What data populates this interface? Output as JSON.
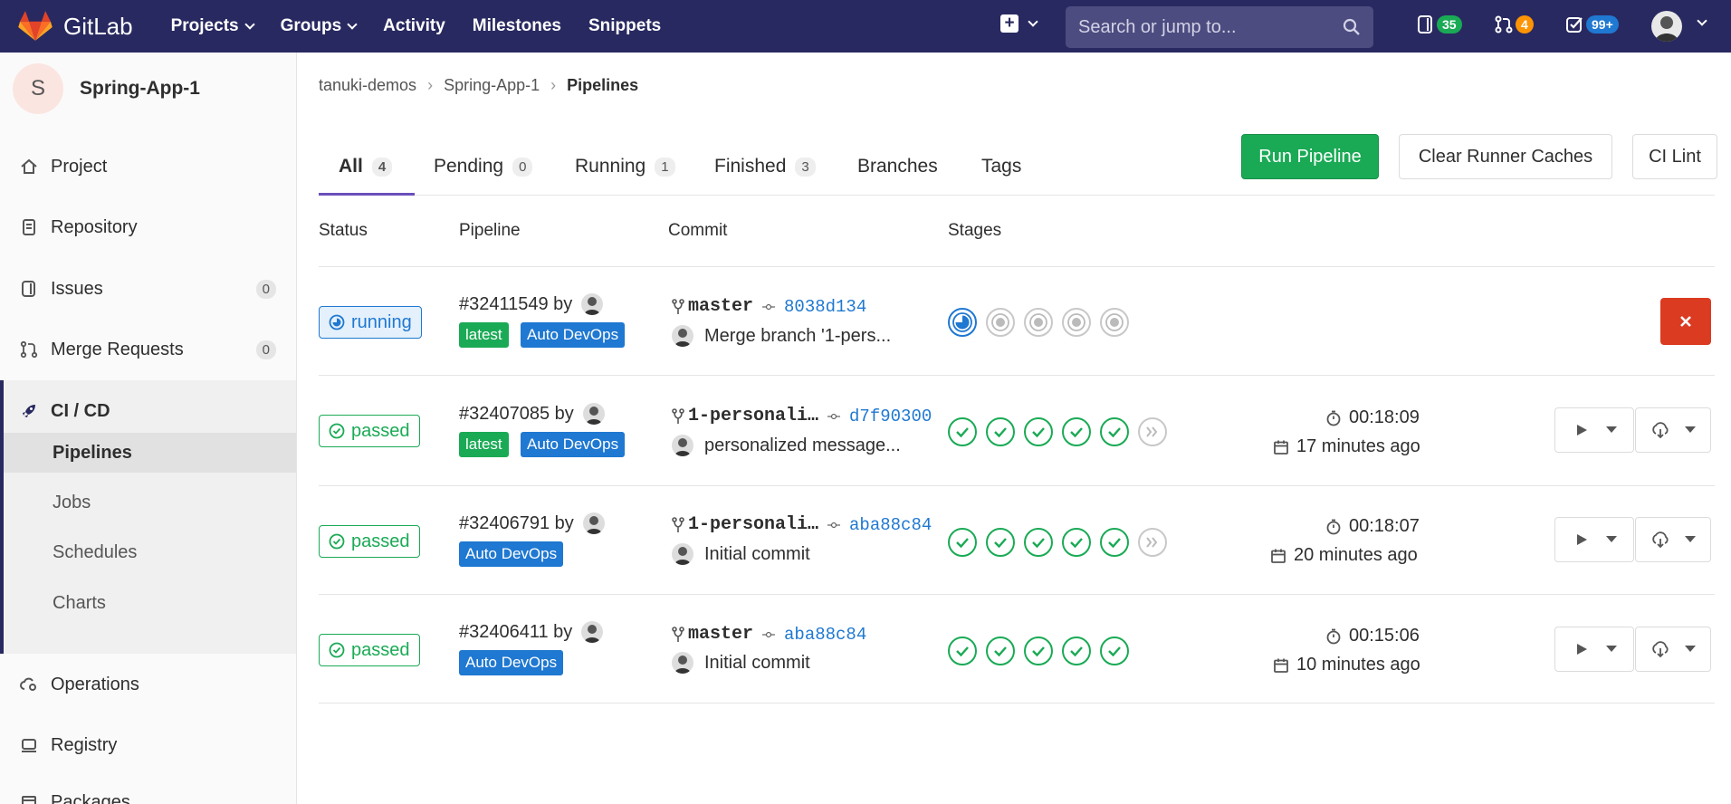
{
  "navbar": {
    "brand": "GitLab",
    "links": [
      "Projects",
      "Groups",
      "Activity",
      "Milestones",
      "Snippets"
    ],
    "search_placeholder": "Search or jump to...",
    "issues_count": "35",
    "mr_count": "4",
    "todos_count": "99+"
  },
  "sidebar": {
    "project_initial": "S",
    "project_name": "Spring-App-1",
    "items": [
      {
        "label": "Project"
      },
      {
        "label": "Repository"
      },
      {
        "label": "Issues",
        "count": "0"
      },
      {
        "label": "Merge Requests",
        "count": "0"
      },
      {
        "label": "CI / CD"
      },
      {
        "label": "Operations"
      },
      {
        "label": "Registry"
      },
      {
        "label": "Packages"
      }
    ],
    "cicd_sub": [
      "Pipelines",
      "Jobs",
      "Schedules",
      "Charts"
    ]
  },
  "breadcrumb": [
    "tanuki-demos",
    "Spring-App-1",
    "Pipelines"
  ],
  "tabs": [
    {
      "label": "All",
      "count": "4"
    },
    {
      "label": "Pending",
      "count": "0"
    },
    {
      "label": "Running",
      "count": "1"
    },
    {
      "label": "Finished",
      "count": "3"
    },
    {
      "label": "Branches"
    },
    {
      "label": "Tags"
    }
  ],
  "actions": {
    "run_pipeline": "Run Pipeline",
    "clear_caches": "Clear Runner Caches",
    "ci_lint": "CI Lint"
  },
  "table_headers": [
    "Status",
    "Pipeline",
    "Commit",
    "Stages"
  ],
  "pipelines": [
    {
      "status": "running",
      "id": "#32411549 by",
      "tags": [
        "latest",
        "Auto DevOps"
      ],
      "ref": "master",
      "sha": "8038d134",
      "message": "Merge branch '1-pers...",
      "duration": "",
      "finished": ""
    },
    {
      "status": "passed",
      "id": "#32407085 by",
      "tags": [
        "latest",
        "Auto DevOps"
      ],
      "ref": "1-personali…",
      "sha": "d7f90300",
      "message": "personalized message...",
      "duration": "00:18:09",
      "finished": "17 minutes ago"
    },
    {
      "status": "passed",
      "id": "#32406791 by",
      "tags": [
        "Auto DevOps"
      ],
      "ref": "1-personali…",
      "sha": "aba88c84",
      "message": "Initial commit",
      "duration": "00:18:07",
      "finished": "20 minutes ago"
    },
    {
      "status": "passed",
      "id": "#32406411 by",
      "tags": [
        "Auto DevOps"
      ],
      "ref": "master",
      "sha": "aba88c84",
      "message": "Initial commit",
      "duration": "00:15:06",
      "finished": "10 minutes ago"
    }
  ],
  "colors": {
    "navbar": "#292961",
    "success": "#1aaa55",
    "running": "#1f78d1",
    "danger": "#db3b21"
  }
}
